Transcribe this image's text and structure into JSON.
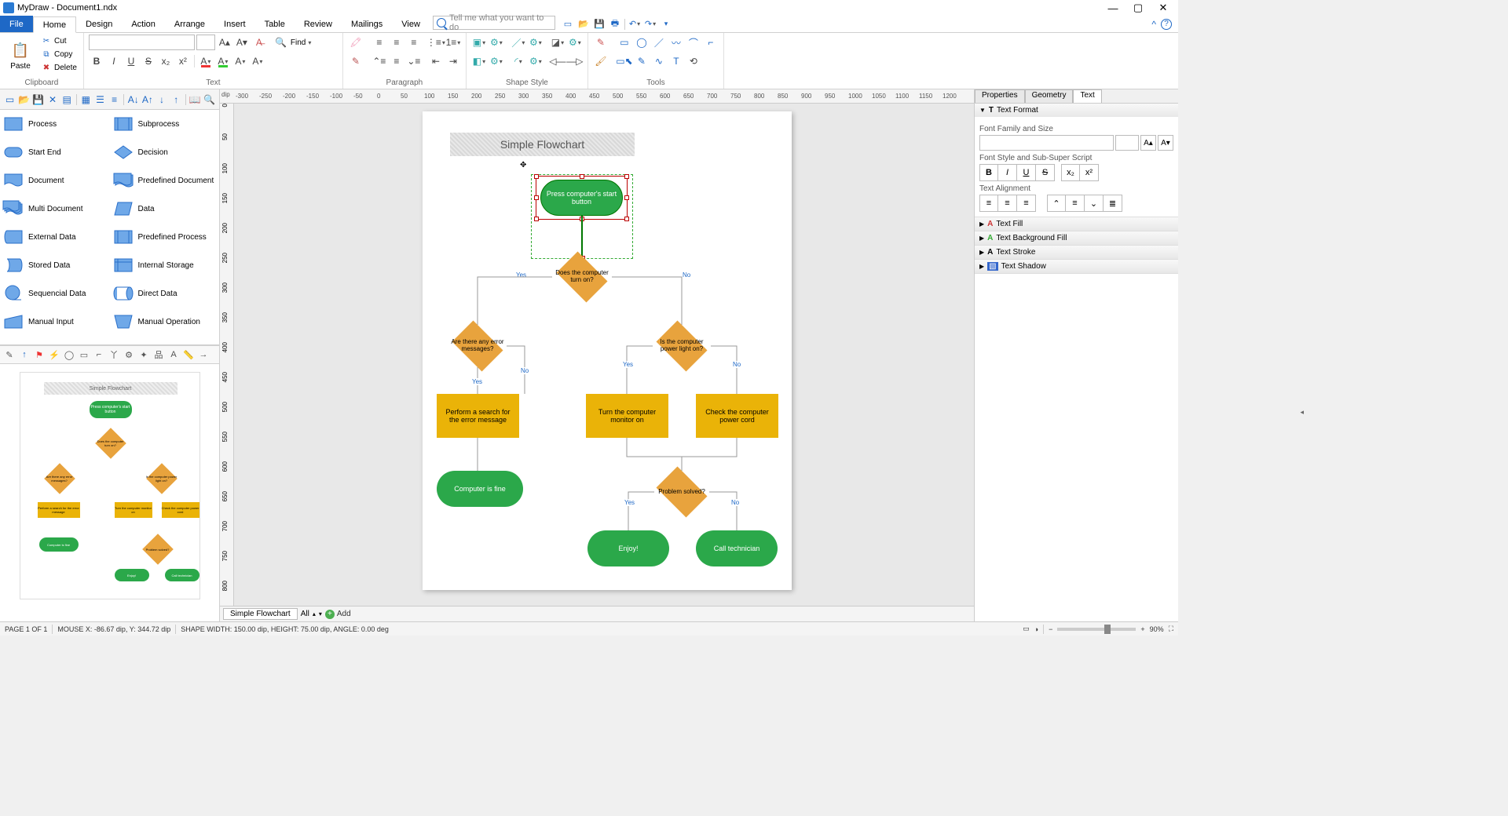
{
  "app_title": "MyDraw - Document1.ndx",
  "menu": {
    "file": "File",
    "home": "Home",
    "design": "Design",
    "action": "Action",
    "arrange": "Arrange",
    "insert": "Insert",
    "table": "Table",
    "review": "Review",
    "mailings": "Mailings",
    "view": "View"
  },
  "search_placeholder": "Tell me what you want to do",
  "ribbon": {
    "clipboard": {
      "paste": "Paste",
      "cut": "Cut",
      "copy": "Copy",
      "delete": "Delete",
      "label": "Clipboard"
    },
    "text_label": "Text",
    "find": "Find",
    "paragraph_label": "Paragraph",
    "shapestyle_label": "Shape Style",
    "tools_label": "Tools"
  },
  "hruler_unit": "dip",
  "shape_palette": [
    "Process",
    "Subprocess",
    "Start End",
    "Decision",
    "Document",
    "Predefined Document",
    "Multi Document",
    "Data",
    "External Data",
    "Predefined Process",
    "Stored Data",
    "Internal Storage",
    "Sequencial Data",
    "Direct Data",
    "Manual Input",
    "Manual Operation"
  ],
  "flowchart": {
    "title": "Simple Flowchart",
    "start": "Press computer's start button",
    "d1": "Does the computer turn on?",
    "d2": "Are there any error messages?",
    "d3": "Is the computer power light on?",
    "a1": "Perform a search for the error message",
    "a2": "Turn the computer monitor on",
    "a3": "Check the computer power cord",
    "t1": "Computer is fine",
    "d4": "Problem solved?",
    "t2": "Enjoy!",
    "t3": "Call technician",
    "yes": "Yes",
    "no": "No"
  },
  "page_tabs": {
    "sheet": "Simple Flowchart",
    "all": "All",
    "add": "Add"
  },
  "right": {
    "tabs": {
      "properties": "Properties",
      "geometry": "Geometry",
      "text": "Text"
    },
    "text_format": "Text Format",
    "family": "Font Family and Size",
    "style": "Font Style and Sub-Super Script",
    "align": "Text Alignment",
    "fill": "Text Fill",
    "bgfill": "Text Background Fill",
    "stroke": "Text Stroke",
    "shadow": "Text Shadow"
  },
  "status": {
    "pages": "PAGE 1 OF 1",
    "mouse": "MOUSE X: -86.67 dip, Y: 344.72 dip",
    "shape": "SHAPE WIDTH: 150.00 dip, HEIGHT: 75.00 dip, ANGLE: 0.00 deg",
    "zoom": "90%"
  },
  "hruler_ticks": [
    -300,
    -250,
    -200,
    -150,
    -100,
    -50,
    0,
    50,
    100,
    150,
    200,
    250,
    300,
    350,
    400,
    450,
    500,
    550,
    600,
    650,
    700,
    750,
    800,
    850,
    900,
    950,
    1000,
    1050,
    1100,
    1150,
    1200
  ],
  "vruler_ticks": [
    0,
    50,
    100,
    150,
    200,
    250,
    300,
    350,
    400,
    450,
    500,
    550,
    600,
    650,
    700,
    750,
    800
  ]
}
